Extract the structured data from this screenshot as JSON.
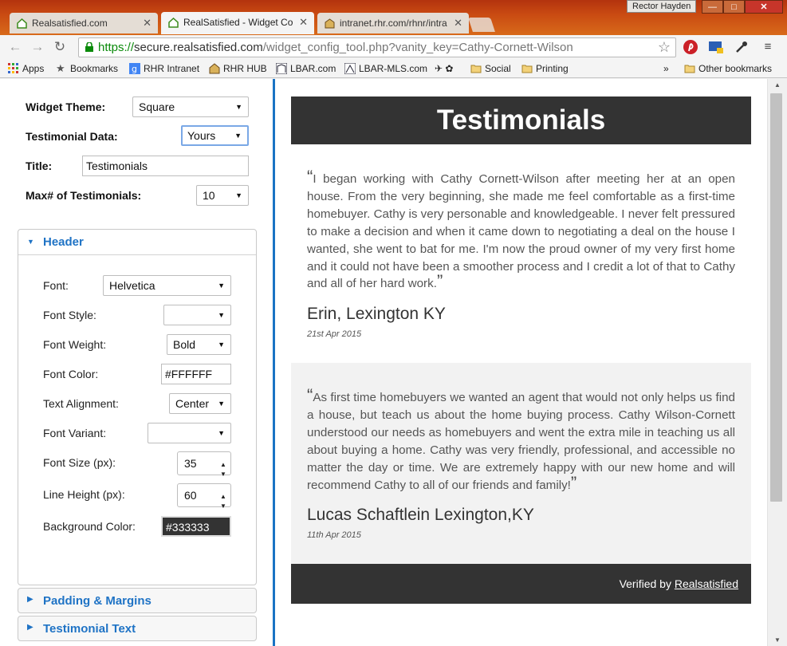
{
  "browser": {
    "tabs": [
      {
        "label": "Realsatisfied.com",
        "active": false
      },
      {
        "label": "RealSatisfied - Widget Co",
        "active": true
      },
      {
        "label": "intranet.rhr.com/rhnr/intra",
        "active": false
      }
    ],
    "profile_name": "Rector Hayden",
    "window_buttons": {
      "min": "—",
      "max": "□",
      "close": "✕"
    },
    "url_scheme": "https://",
    "url_host": "secure.realsatisfied.com",
    "url_path": "/widget_config_tool.php?vanity_key=Cathy-Cornett-Wilson",
    "bookmarks": [
      "Apps",
      "Bookmarks",
      "RHR Intranet",
      "RHR HUB",
      "LBAR.com",
      "LBAR-MLS.com",
      "Social",
      "Printing"
    ],
    "bookmarks_overflow": "»",
    "other_bookmarks": "Other bookmarks"
  },
  "config": {
    "widget_theme": {
      "label": "Widget Theme:",
      "value": "Square"
    },
    "testimonial_data": {
      "label": "Testimonial Data:",
      "value": "Yours"
    },
    "title": {
      "label": "Title:",
      "value": "Testimonials"
    },
    "max_testimonials": {
      "label": "Max# of Testimonials:",
      "value": "10"
    },
    "header_section": {
      "title": "Header",
      "font": {
        "label": "Font:",
        "value": "Helvetica"
      },
      "font_style": {
        "label": "Font Style:",
        "value": ""
      },
      "font_weight": {
        "label": "Font Weight:",
        "value": "Bold"
      },
      "font_color": {
        "label": "Font Color:",
        "value": "#FFFFFF"
      },
      "text_alignment": {
        "label": "Text Alignment:",
        "value": "Center"
      },
      "font_variant": {
        "label": "Font Variant:",
        "value": ""
      },
      "font_size": {
        "label": "Font Size (px):",
        "value": "35"
      },
      "line_height": {
        "label": "Line Height (px):",
        "value": "60"
      },
      "background_color": {
        "label": "Background Color:",
        "value": "#333333"
      }
    },
    "padding_section": {
      "title": "Padding & Margins"
    },
    "testimonial_text_section": {
      "title": "Testimonial Text"
    }
  },
  "preview": {
    "header_title": "Testimonials",
    "header_bg": "#333333",
    "header_color": "#FFFFFF",
    "testimonials": [
      {
        "text": "I began working with Cathy Cornett-Wilson after meeting her at an open house. From the very beginning, she made me feel comfortable as a first-time homebuyer. Cathy is very personable and knowledgeable. I never felt pressured to make a decision and when it came down to negotiating a deal on the house I wanted, she went to bat for me. I'm now the proud owner of my very first home and it could not have been a smoother process and I credit a lot of that to Cathy and all of her hard work.",
        "author": "Erin, Lexington KY",
        "date": "21st Apr 2015"
      },
      {
        "text": "As first time homebuyers we wanted an agent that would not only helps us find a house, but teach us about the home buying process. Cathy Wilson-Cornett understood our needs as homebuyers and went the extra mile in teaching us all about buying a home. Cathy was very friendly, professional, and accessible no matter the day or time. We are extremely happy with our new home and will recommend Cathy to all of our friends and family!",
        "author": "Lucas Schaftlein Lexington,KY",
        "date": "11th Apr 2015"
      }
    ],
    "footer_prefix": "Verified by ",
    "footer_link": "Realsatisfied"
  }
}
